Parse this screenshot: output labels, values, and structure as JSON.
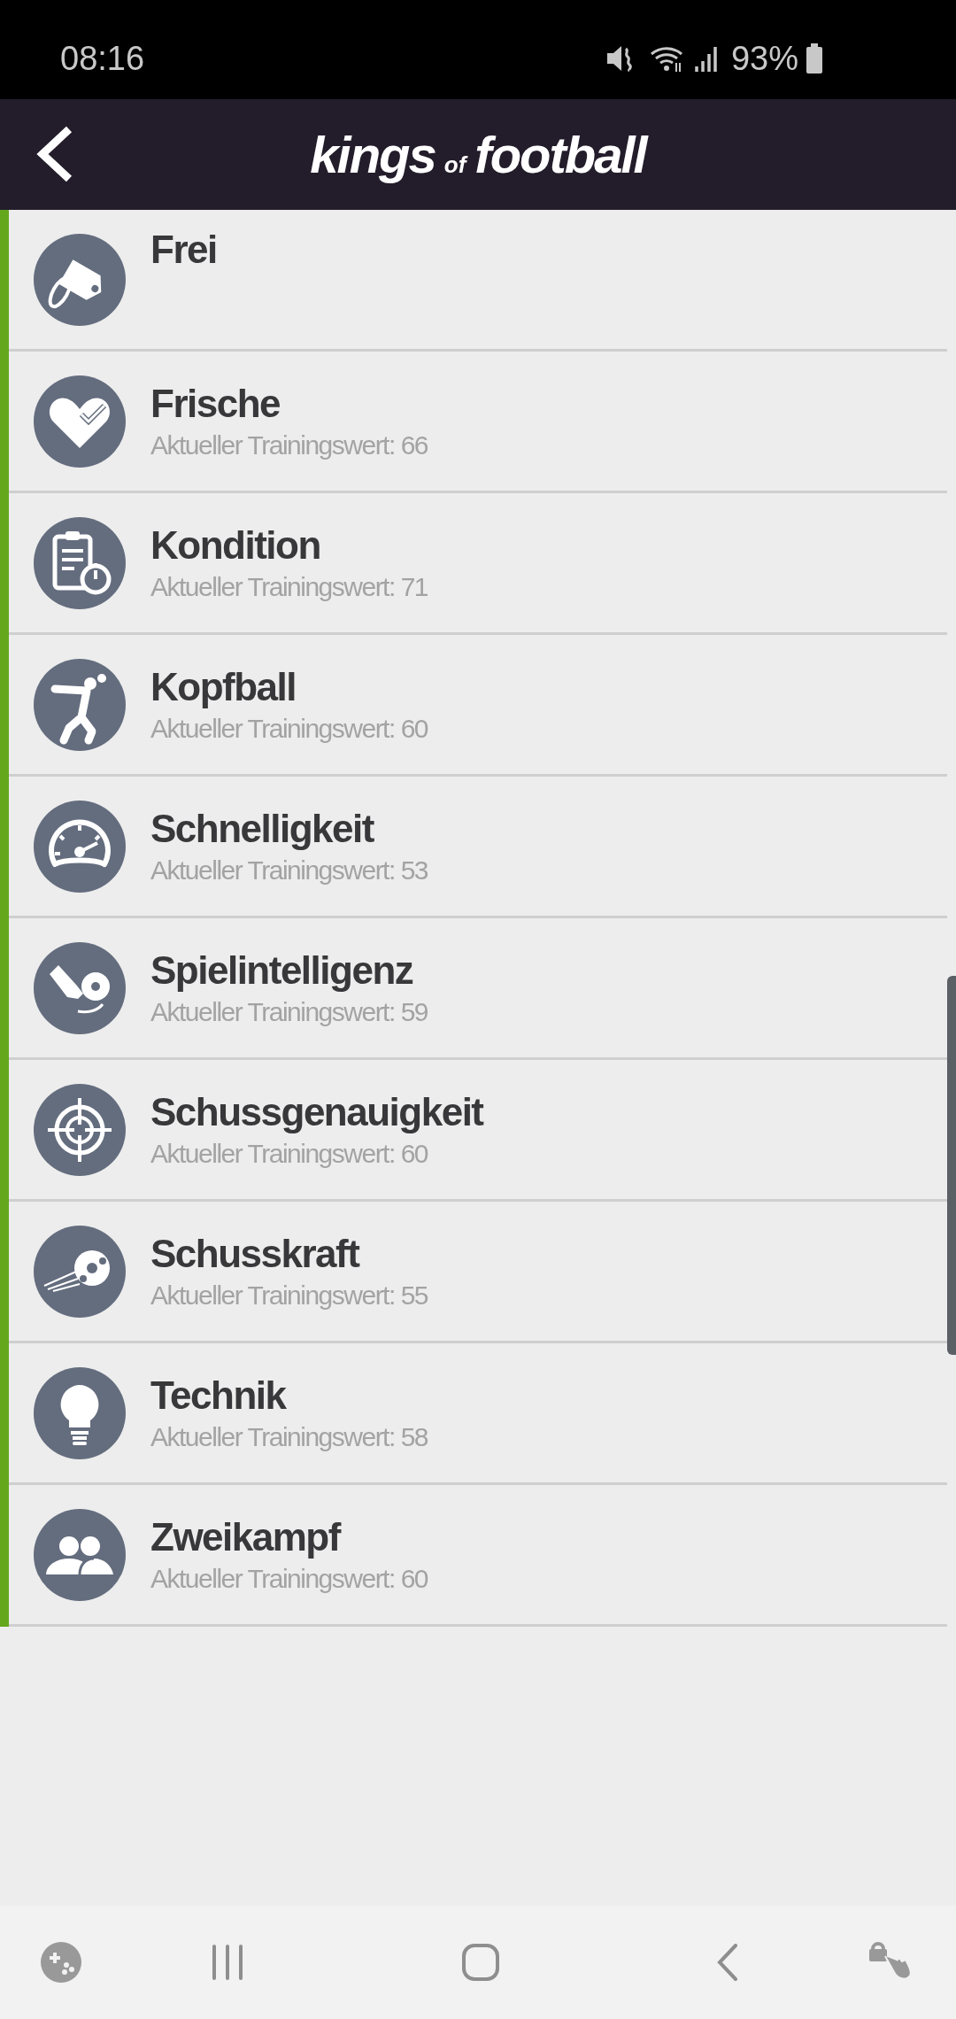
{
  "status_bar": {
    "time": "08:16",
    "battery": "93%"
  },
  "app_bar": {
    "logo": [
      "kings",
      "of",
      "football"
    ]
  },
  "items": [
    {
      "title": "Frei"
    },
    {
      "title": "Frische",
      "subtitle": "Aktueller Trainingswert: 66"
    },
    {
      "title": "Kondition",
      "subtitle": "Aktueller Trainingswert: 71"
    },
    {
      "title": "Kopfball",
      "subtitle": "Aktueller Trainingswert: 60"
    },
    {
      "title": "Schnelligkeit",
      "subtitle": "Aktueller Trainingswert: 53"
    },
    {
      "title": "Spielintelligenz",
      "subtitle": "Aktueller Trainingswert: 59"
    },
    {
      "title": "Schussgenauigkeit",
      "subtitle": "Aktueller Trainingswert: 60"
    },
    {
      "title": "Schusskraft",
      "subtitle": "Aktueller Trainingswert: 55"
    },
    {
      "title": "Technik",
      "subtitle": "Aktueller Trainingswert: 58"
    },
    {
      "title": "Zweikampf",
      "subtitle": "Aktueller Trainingswert: 60"
    }
  ]
}
